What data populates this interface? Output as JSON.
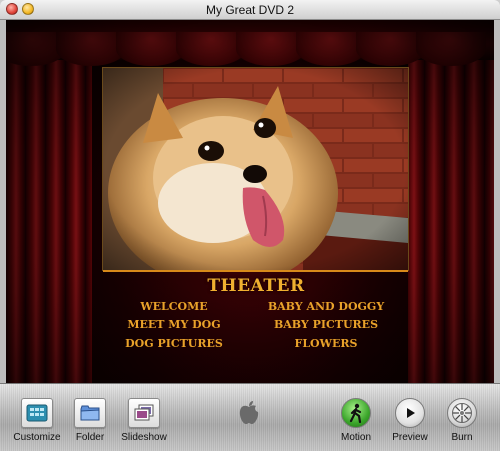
{
  "window": {
    "title": "My Great DVD 2"
  },
  "menu": {
    "title": "THEATER",
    "left_items": [
      "WELCOME",
      "MEET MY DOG",
      "DOG PICTURES"
    ],
    "right_items": [
      "BABY AND DOGGY",
      "BABY PICTURES",
      "FLOWERS"
    ]
  },
  "toolbar": {
    "customize_label": "Customize",
    "folder_label": "Folder",
    "slideshow_label": "Slideshow",
    "motion_label": "Motion",
    "preview_label": "Preview",
    "burn_label": "Burn"
  },
  "colors": {
    "menu_text": "#e9a22a",
    "motion_active": "#3aa52a",
    "curtain_red": "#a0151a"
  },
  "icons": {
    "close": "close-button-icon",
    "minimize": "minimize-button-icon",
    "customize": "customize-panel-icon",
    "folder": "folder-icon",
    "slideshow": "slideshow-icon",
    "apple": "apple-logo-icon",
    "motion": "walking-figure-icon",
    "preview": "play-icon",
    "burn": "burn-disc-icon"
  }
}
